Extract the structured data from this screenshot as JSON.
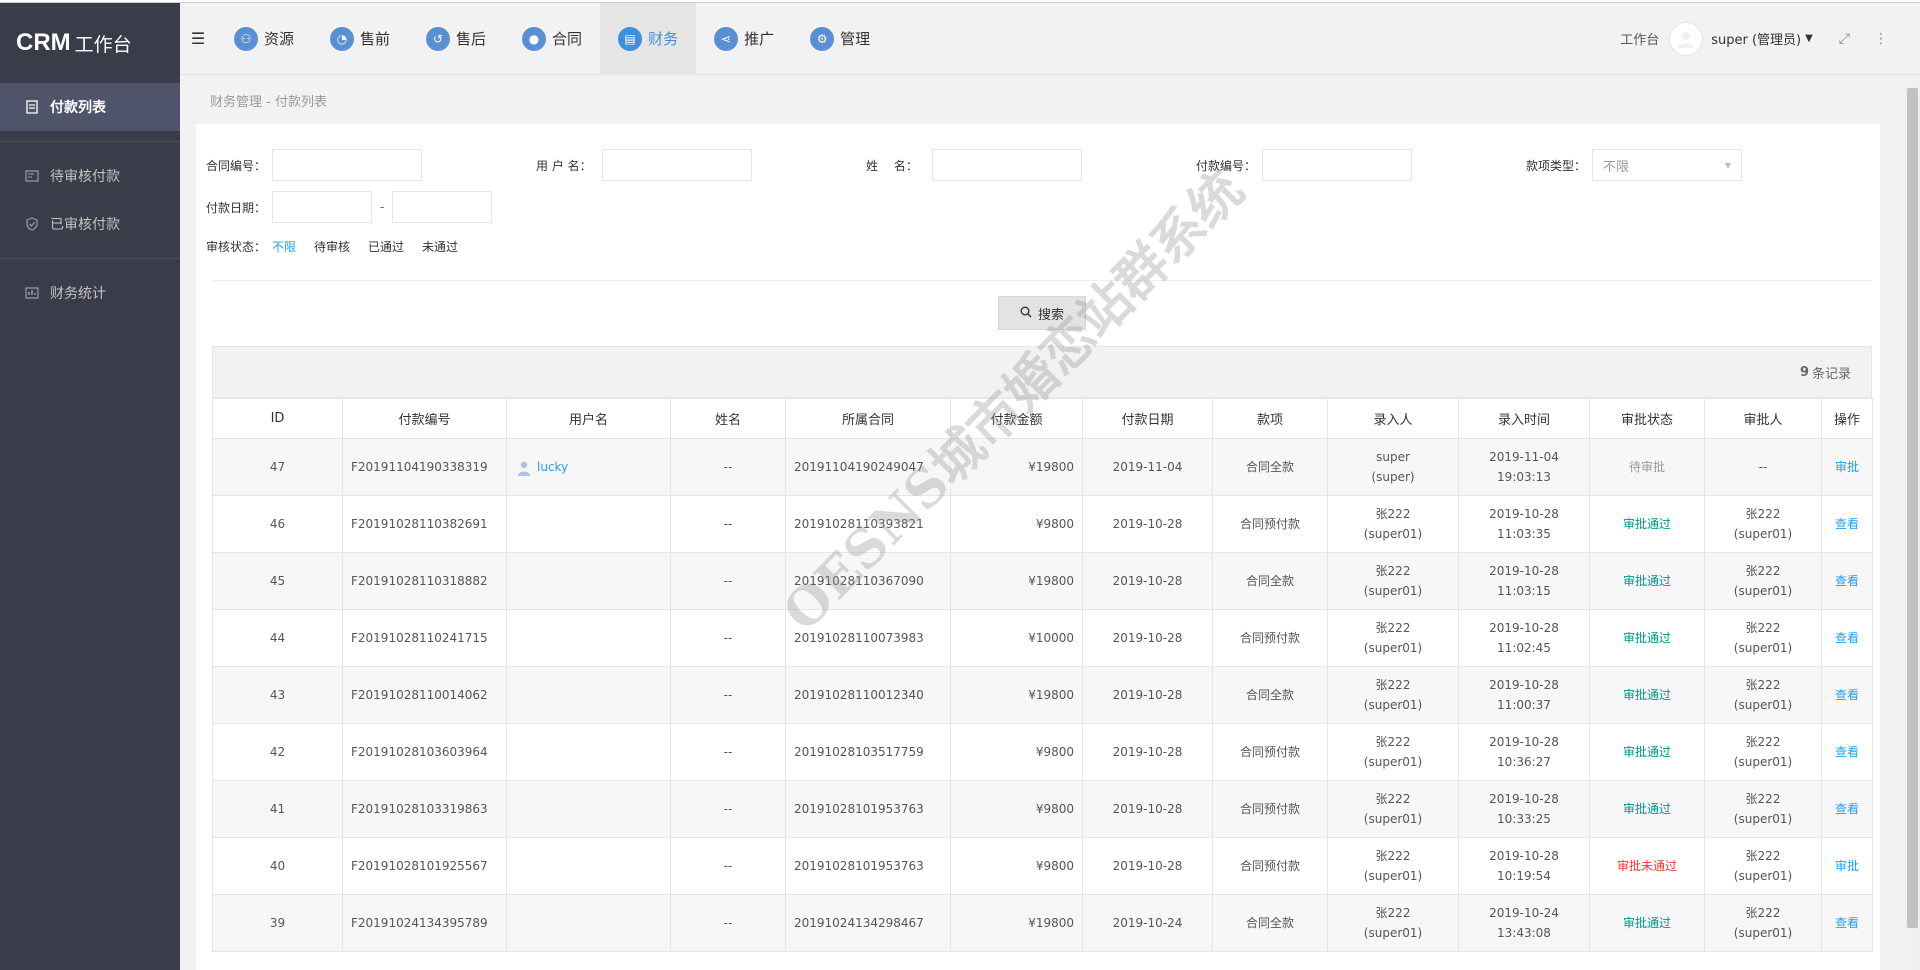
{
  "app": {
    "logo_bold": "CRM",
    "logo_text": "工作台"
  },
  "sidebar": {
    "items": [
      {
        "label": "付款列表",
        "icon": "receipt-icon",
        "active": true
      },
      {
        "label": "待审核付款",
        "icon": "pending-list-icon"
      },
      {
        "label": "已审核付款",
        "icon": "shield-check-icon"
      },
      {
        "label": "财务统计",
        "icon": "chart-icon"
      }
    ]
  },
  "header": {
    "nav": [
      {
        "label": "资源",
        "icon": "resource-icon"
      },
      {
        "label": "售前",
        "icon": "presale-icon"
      },
      {
        "label": "售后",
        "icon": "aftersale-icon"
      },
      {
        "label": "合同",
        "icon": "contract-icon"
      },
      {
        "label": "财务",
        "icon": "finance-icon",
        "active": true
      },
      {
        "label": "推广",
        "icon": "share-icon"
      },
      {
        "label": "管理",
        "icon": "settings-icon"
      }
    ],
    "workbench": "工作台",
    "user": "super (管理员)"
  },
  "breadcrumb": "财务管理 - 付款列表",
  "filters": {
    "contract_no": "合同编号：",
    "username": "用 户 名：",
    "name": "姓　 名：",
    "payment_no": "付款编号：",
    "type": "款项类型：",
    "type_value": "不限",
    "date": "付款日期：",
    "date_dash": "-",
    "status": "审核状态：",
    "status_options": [
      "不限",
      "待审核",
      "已通过",
      "未通过"
    ],
    "search": "搜索"
  },
  "table": {
    "count_num": "9",
    "count_text": "条记录",
    "headers": [
      "ID",
      "付款编号",
      "用户名",
      "姓名",
      "所属合同",
      "付款金额",
      "付款日期",
      "款项",
      "录入人",
      "录入时间",
      "审批状态",
      "审批人",
      "操作"
    ],
    "rows": [
      {
        "id": "47",
        "no": "F20191104190338319",
        "user": "lucky",
        "name": "--",
        "contract": "20191104190249047",
        "amount": "¥19800",
        "date": "2019-11-04",
        "type": "合同全款",
        "entry1": "super",
        "entry2": "(super)",
        "time1": "2019-11-04",
        "time2": "19:03:13",
        "status": "待审批",
        "status_kind": "pending",
        "approver1": "--",
        "approver2": "",
        "op": "审批"
      },
      {
        "id": "46",
        "no": "F20191028110382691",
        "user": "",
        "name": "--",
        "contract": "20191028110393821",
        "amount": "¥9800",
        "date": "2019-10-28",
        "type": "合同预付款",
        "entry1": "张222",
        "entry2": "(super01)",
        "time1": "2019-10-28",
        "time2": "11:03:35",
        "status": "审批通过",
        "status_kind": "ok",
        "approver1": "张222",
        "approver2": "(super01)",
        "op": "查看"
      },
      {
        "id": "45",
        "no": "F20191028110318882",
        "user": "",
        "name": "--",
        "contract": "20191028110367090",
        "amount": "¥19800",
        "date": "2019-10-28",
        "type": "合同全款",
        "entry1": "张222",
        "entry2": "(super01)",
        "time1": "2019-10-28",
        "time2": "11:03:15",
        "status": "审批通过",
        "status_kind": "ok",
        "approver1": "张222",
        "approver2": "(super01)",
        "op": "查看"
      },
      {
        "id": "44",
        "no": "F20191028110241715",
        "user": "",
        "name": "--",
        "contract": "20191028110073983",
        "amount": "¥10000",
        "date": "2019-10-28",
        "type": "合同预付款",
        "entry1": "张222",
        "entry2": "(super01)",
        "time1": "2019-10-28",
        "time2": "11:02:45",
        "status": "审批通过",
        "status_kind": "ok",
        "approver1": "张222",
        "approver2": "(super01)",
        "op": "查看"
      },
      {
        "id": "43",
        "no": "F20191028110014062",
        "user": "",
        "name": "--",
        "contract": "20191028110012340",
        "amount": "¥19800",
        "date": "2019-10-28",
        "type": "合同全款",
        "entry1": "张222",
        "entry2": "(super01)",
        "time1": "2019-10-28",
        "time2": "11:00:37",
        "status": "审批通过",
        "status_kind": "ok",
        "approver1": "张222",
        "approver2": "(super01)",
        "op": "查看"
      },
      {
        "id": "42",
        "no": "F20191028103603964",
        "user": "",
        "name": "--",
        "contract": "20191028103517759",
        "amount": "¥9800",
        "date": "2019-10-28",
        "type": "合同预付款",
        "entry1": "张222",
        "entry2": "(super01)",
        "time1": "2019-10-28",
        "time2": "10:36:27",
        "status": "审批通过",
        "status_kind": "ok",
        "approver1": "张222",
        "approver2": "(super01)",
        "op": "查看"
      },
      {
        "id": "41",
        "no": "F20191028103319863",
        "user": "",
        "name": "--",
        "contract": "20191028101953763",
        "amount": "¥9800",
        "date": "2019-10-28",
        "type": "合同预付款",
        "entry1": "张222",
        "entry2": "(super01)",
        "time1": "2019-10-28",
        "time2": "10:33:25",
        "status": "审批通过",
        "status_kind": "ok",
        "approver1": "张222",
        "approver2": "(super01)",
        "op": "查看"
      },
      {
        "id": "40",
        "no": "F20191028101925567",
        "user": "",
        "name": "--",
        "contract": "20191028101953763",
        "amount": "¥9800",
        "date": "2019-10-28",
        "type": "合同预付款",
        "entry1": "张222",
        "entry2": "(super01)",
        "time1": "2019-10-28",
        "time2": "10:19:54",
        "status": "审批未通过",
        "status_kind": "rejected",
        "approver1": "张222",
        "approver2": "(super01)",
        "op": "审批"
      },
      {
        "id": "39",
        "no": "F20191024134395789",
        "user": "",
        "name": "--",
        "contract": "20191024134298467",
        "amount": "¥19800",
        "date": "2019-10-24",
        "type": "合同全款",
        "entry1": "张222",
        "entry2": "(super01)",
        "time1": "2019-10-24",
        "time2": "13:43:08",
        "status": "审批通过",
        "status_kind": "ok",
        "approver1": "张222",
        "approver2": "(super01)",
        "op": "查看"
      }
    ]
  },
  "watermark": "OESNS城市婚恋站群系统",
  "colors": {
    "accent": "#1e9fff",
    "approved": "#009688",
    "rejected": "#ff3333",
    "sidebar": "#393d49"
  }
}
